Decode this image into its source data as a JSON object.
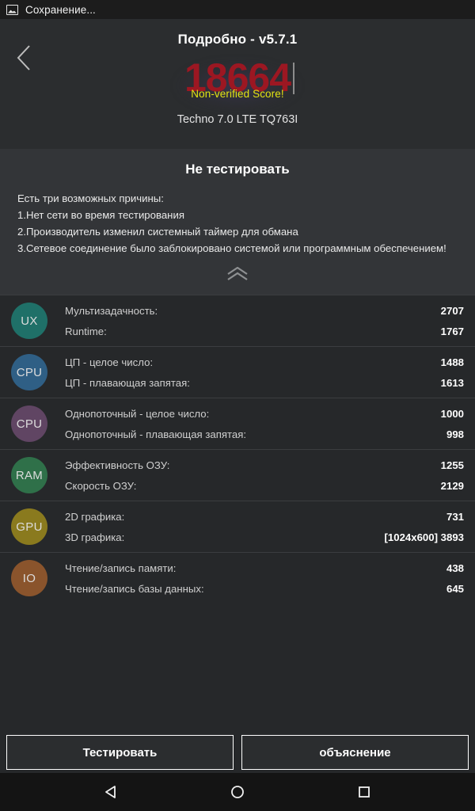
{
  "statusbar": {
    "icon": "image-saving-icon",
    "text": "Сохранение..."
  },
  "header": {
    "back_icon": "chevron-left-icon",
    "title": "Подробно - v5.7.1",
    "score": "18664",
    "score_note": "Non-verified Score!",
    "device": "Techno 7.0 LTE TQ763I",
    "score_color": "#9c1722",
    "note_color": "#e3e312"
  },
  "warning": {
    "title": "Не тестировать",
    "intro": "Есть три возможных причины:",
    "reasons": [
      "1.Нет сети во время тестирования",
      "2.Производитель изменил системный таймер для обмана",
      "3.Сетевое соединение было заблокировано системой или программным обеспечением!"
    ],
    "collapse_icon": "double-chevron-up-icon"
  },
  "scores": [
    {
      "badge": "UX",
      "color": "#1f7068",
      "lines": [
        {
          "label": "Мультизадачность:",
          "value": "2707"
        },
        {
          "label": "Runtime:",
          "value": "1767"
        }
      ]
    },
    {
      "badge": "CPU",
      "color": "#2f5f85",
      "lines": [
        {
          "label": "ЦП - целое число:",
          "value": "1488"
        },
        {
          "label": "ЦП - плавающая запятая:",
          "value": "1613"
        }
      ]
    },
    {
      "badge": "CPU",
      "color": "#604563",
      "lines": [
        {
          "label": "Однопоточный - целое число:",
          "value": "1000"
        },
        {
          "label": "Однопоточный - плавающая запятая:",
          "value": "998"
        }
      ]
    },
    {
      "badge": "RAM",
      "color": "#2f7049",
      "lines": [
        {
          "label": "Эффективность ОЗУ:",
          "value": "1255"
        },
        {
          "label": "Скорость ОЗУ:",
          "value": "2129"
        }
      ]
    },
    {
      "badge": "GPU",
      "color": "#8a7a1e",
      "lines": [
        {
          "label": "2D графика:",
          "value": "731"
        },
        {
          "label": "3D графика:",
          "value": "[1024x600] 3893"
        }
      ]
    },
    {
      "badge": "IO",
      "color": "#8a542c",
      "lines": [
        {
          "label": "Чтение/запись памяти:",
          "value": "438"
        },
        {
          "label": "Чтение/запись базы данных:",
          "value": "645"
        }
      ]
    }
  ],
  "actions": {
    "test_label": "Тестировать",
    "explain_label": "объяснение"
  },
  "navbar": {
    "back_icon": "triangle-back-icon",
    "home_icon": "circle-home-icon",
    "recents_icon": "square-recents-icon"
  }
}
